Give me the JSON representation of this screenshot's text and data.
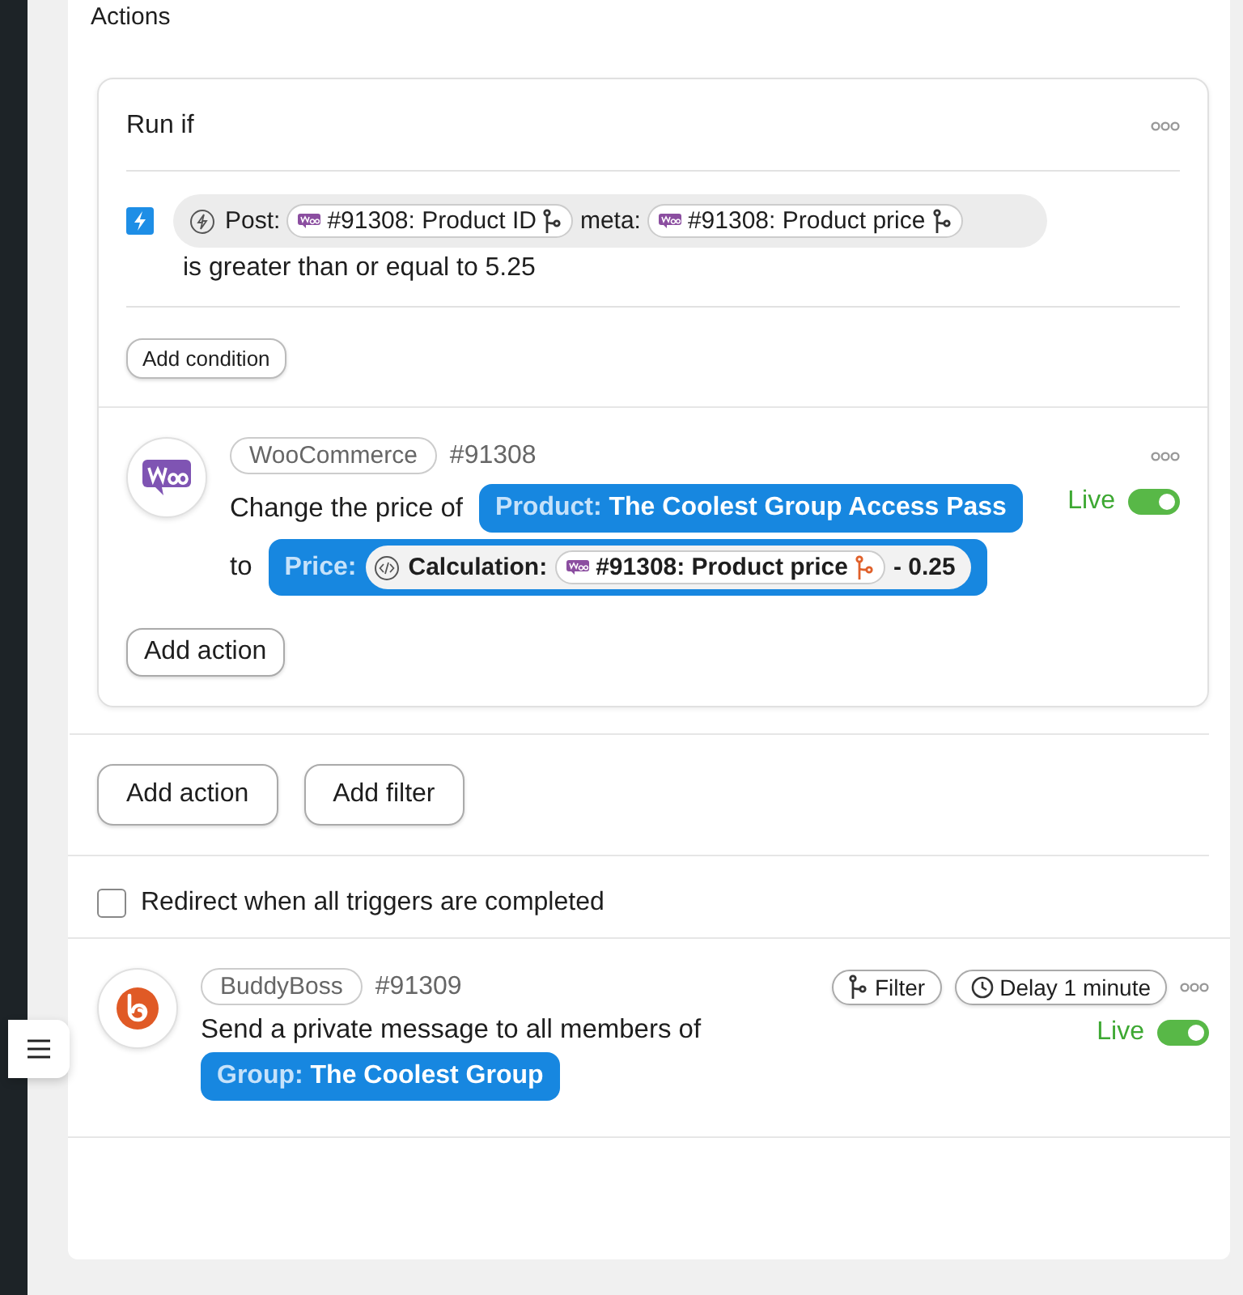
{
  "section_title": "Actions",
  "recipe_card": {
    "run_if": {
      "title": "Run if",
      "conditions": [
        {
          "parts": [
            {
              "kind": "text",
              "text": "Post:"
            },
            {
              "kind": "token",
              "text": "#91308: Product ID"
            },
            {
              "kind": "text",
              "text": "meta:"
            },
            {
              "kind": "token",
              "text": "#91308: Product price"
            }
          ],
          "comparison": "is greater than or equal to 5.25"
        }
      ],
      "add_button": "Add condition"
    },
    "actions": [
      {
        "integration": "WooCommerce",
        "kind": "woo",
        "id": "#91308",
        "live": {
          "label": "Live",
          "on": true
        },
        "lines": [
          [
            {
              "kind": "text",
              "text": "Change the price of"
            },
            {
              "kind": "field",
              "label": "Product:",
              "value": "The Coolest Group Access Pass"
            }
          ],
          [
            {
              "kind": "text",
              "text": "to"
            },
            {
              "kind": "calc_field",
              "label": "Price:",
              "calc_label": "Calculation:",
              "token": "#91308: Product price",
              "suffix": "- 0.25"
            }
          ]
        ],
        "add_button": "Add action"
      }
    ]
  },
  "footer_buttons": [
    "Add action",
    "Add filter"
  ],
  "redirect": {
    "label": "Redirect when all triggers are completed",
    "checked": false
  },
  "actions": [
    {
      "integration": "BuddyBoss",
      "kind": "buddyboss",
      "id": "#91309",
      "filter_button": "Filter",
      "delay_button": "Delay 1 minute",
      "live": {
        "label": "Live",
        "on": true
      },
      "lines": [
        [
          {
            "kind": "text",
            "text": "Send a private message to all members of"
          }
        ],
        [
          {
            "kind": "field",
            "label": "Group:",
            "value": "The Coolest Group"
          }
        ]
      ]
    }
  ]
}
